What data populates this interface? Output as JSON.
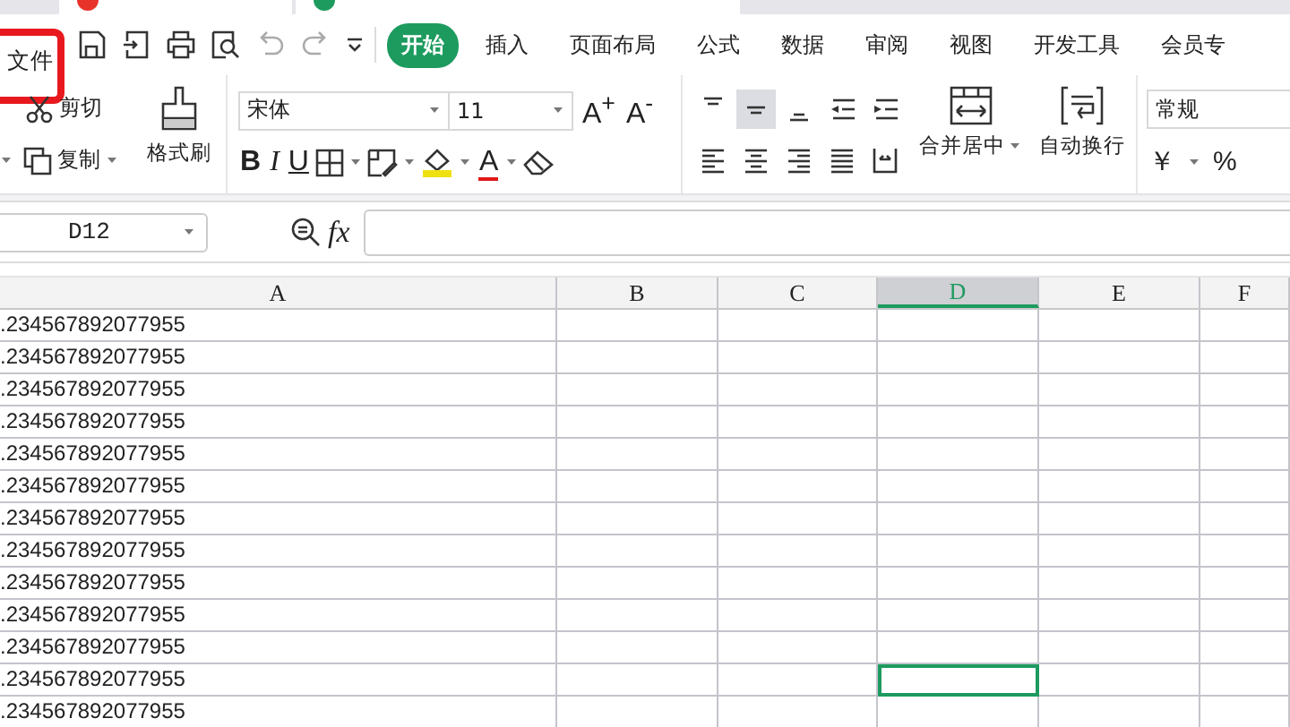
{
  "file_menu": {
    "label": "文件",
    "highlighted": true
  },
  "ribbon_tabs": [
    {
      "label": "开始",
      "selected": true
    },
    {
      "label": "插入",
      "selected": false
    },
    {
      "label": "页面布局",
      "selected": false
    },
    {
      "label": "公式",
      "selected": false
    },
    {
      "label": "数据",
      "selected": false
    },
    {
      "label": "审阅",
      "selected": false
    },
    {
      "label": "视图",
      "selected": false
    },
    {
      "label": "开发工具",
      "selected": false
    },
    {
      "label": "会员专",
      "selected": false
    }
  ],
  "clipboard": {
    "cut": "剪切",
    "copy": "复制",
    "format_painter": "格式刷"
  },
  "font": {
    "name": "宋体",
    "size": "11",
    "grow": "A$^{+}$",
    "shrink": "A$^{-}$",
    "styles": [
      {
        "kind": "bold",
        "label": "B"
      },
      {
        "kind": "italic",
        "label": "I"
      },
      {
        "kind": "underline",
        "label": "U"
      }
    ],
    "font_color": "A"
  },
  "alignment": {
    "buttons": [
      {
        "kind": "top",
        "selected": false
      },
      {
        "kind": "middle",
        "selected": true
      },
      {
        "kind": "bottom",
        "selected": false
      },
      {
        "kind": "outdent",
        "selected": false
      },
      {
        "kind": "indent",
        "selected": false
      },
      {
        "kind": "left",
        "selected": false
      },
      {
        "kind": "center",
        "selected": false
      },
      {
        "kind": "right",
        "selected": false
      },
      {
        "kind": "justify",
        "selected": false
      },
      {
        "kind": "distributed",
        "selected": false
      }
    ],
    "merge": "合并居中",
    "wrap": "自动换行"
  },
  "number": {
    "format": "常规",
    "currency": "￥",
    "percent": "%"
  },
  "formula_bar": {
    "name_box": "D12",
    "function_label": "fx"
  },
  "columns": [
    {
      "label": "A",
      "selected": false
    },
    {
      "label": "B",
      "selected": false
    },
    {
      "label": "C",
      "selected": false
    },
    {
      "label": "D",
      "selected": true
    },
    {
      "label": "E",
      "selected": false
    },
    {
      "label": "F",
      "selected": false
    }
  ],
  "rows": [
    {
      "cell_a": ".234567892077955",
      "selected": false
    },
    {
      "cell_a": ".234567892077955",
      "selected": false
    },
    {
      "cell_a": ".234567892077955",
      "selected": false
    },
    {
      "cell_a": ".234567892077955",
      "selected": false
    },
    {
      "cell_a": ".234567892077955",
      "selected": false
    },
    {
      "cell_a": ".234567892077955",
      "selected": false
    },
    {
      "cell_a": ".234567892077955",
      "selected": false
    },
    {
      "cell_a": ".234567892077955",
      "selected": false
    },
    {
      "cell_a": ".234567892077955",
      "selected": false
    },
    {
      "cell_a": ".234567892077955",
      "selected": false
    },
    {
      "cell_a": ".234567892077955",
      "selected": false
    },
    {
      "cell_a": ".234567892077955",
      "selected": true
    },
    {
      "cell_a": ".234567892077955",
      "selected": false
    }
  ]
}
